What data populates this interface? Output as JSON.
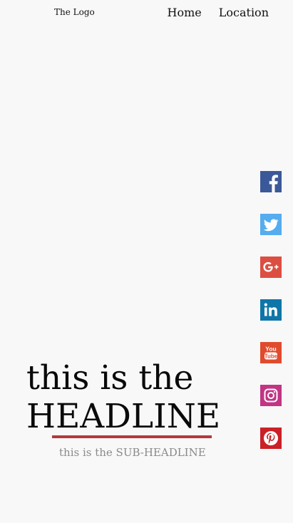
{
  "header": {
    "logo_text": "The Logo",
    "nav": [
      {
        "label": "Home"
      },
      {
        "label": "Location"
      }
    ]
  },
  "social": [
    {
      "icon": "facebook-icon",
      "color": "#3b5998"
    },
    {
      "icon": "twitter-icon",
      "color": "#55acee"
    },
    {
      "icon": "google-plus-icon",
      "color": "#dc4e41"
    },
    {
      "icon": "linkedin-icon",
      "color": "#0e76a8"
    },
    {
      "icon": "youtube-icon",
      "color": "#e04b2e"
    },
    {
      "icon": "instagram-icon",
      "color": "#c13584"
    },
    {
      "icon": "pinterest-icon",
      "color": "#cb2027"
    }
  ],
  "hero": {
    "headline_line1": "this is the",
    "headline_line2": "HEADLINE",
    "subheadline": "this is the SUB-HEADLINE",
    "accent_color": "#b23a3a"
  }
}
